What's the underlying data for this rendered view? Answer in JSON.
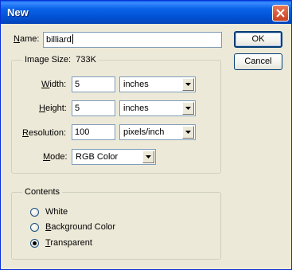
{
  "window": {
    "title": "New"
  },
  "name_field": {
    "label_before": "",
    "label_accel": "N",
    "label_after": "ame:",
    "value": "billiard"
  },
  "image_size": {
    "legend_label": "Image Size:",
    "value": "733K"
  },
  "width": {
    "label_accel": "W",
    "label_after": "idth:",
    "value": "5",
    "unit": "inches"
  },
  "height": {
    "label_accel": "H",
    "label_after": "eight:",
    "value": "5",
    "unit": "inches"
  },
  "resolution": {
    "label_accel": "R",
    "label_after": "esolution:",
    "value": "100",
    "unit": "pixels/inch"
  },
  "mode": {
    "label_accel": "M",
    "label_after": "ode:",
    "value": "RGB Color"
  },
  "contents": {
    "legend": "Contents",
    "options": [
      {
        "accel": "",
        "rest": "White",
        "selected": false
      },
      {
        "accel": "B",
        "rest": "ackground Color",
        "selected": false
      },
      {
        "accel": "T",
        "rest": "ransparent",
        "selected": true
      }
    ]
  },
  "buttons": {
    "ok": "OK",
    "cancel": "Cancel"
  },
  "colors": {
    "title_bar": "#0a5de0",
    "dialog_bg": "#ece9d8",
    "close_button": "#c84020"
  }
}
